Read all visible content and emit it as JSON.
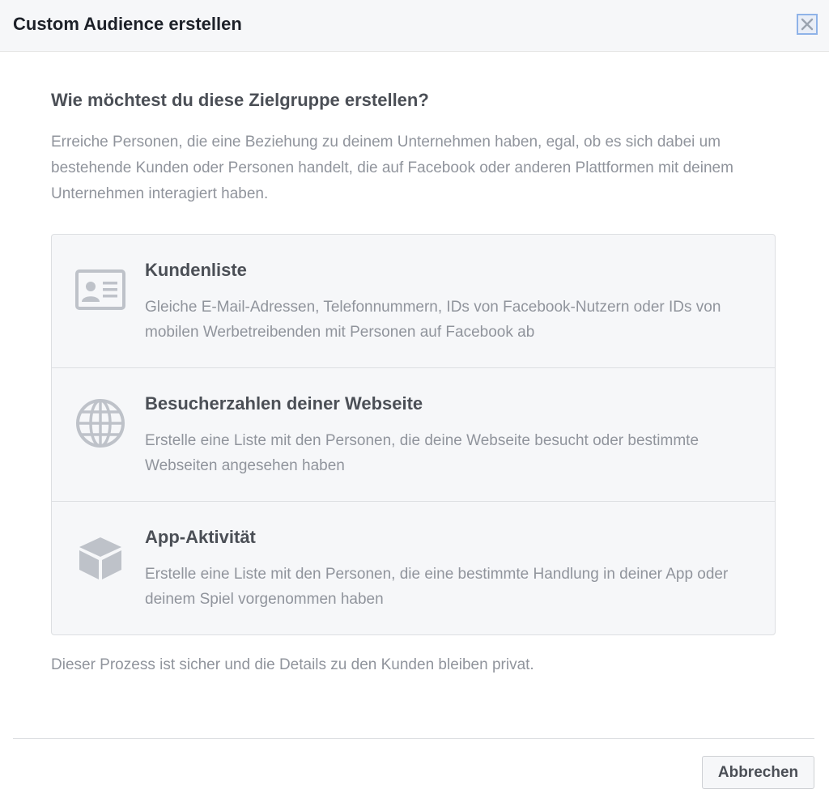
{
  "dialog": {
    "title": "Custom Audience erstellen",
    "close_icon": "close-icon"
  },
  "content": {
    "question": "Wie möchtest du diese Zielgruppe erstellen?",
    "intro": "Erreiche Personen, die eine Beziehung zu deinem Unternehmen haben, egal, ob es sich dabei um bestehende Kunden oder Personen handelt, die auf Facebook oder anderen Plattformen mit deinem Unternehmen interagiert haben.",
    "options": [
      {
        "icon": "contact-card-icon",
        "title": "Kundenliste",
        "description": "Gleiche E-Mail-Adressen, Telefonnummern, IDs von Facebook-Nutzern oder IDs von mobilen Werbetreibenden mit Personen auf Facebook ab"
      },
      {
        "icon": "globe-icon",
        "title": "Besucherzahlen deiner Webseite",
        "description": "Erstelle eine Liste mit den Personen, die deine Webseite besucht oder bestimmte Webseiten angesehen haben"
      },
      {
        "icon": "cube-icon",
        "title": "App-Aktivität",
        "description": "Erstelle eine Liste mit den Personen, die eine bestimmte Handlung in deiner App oder deinem Spiel vorgenommen haben"
      }
    ],
    "privacy_note": "Dieser Prozess ist sicher und die Details zu den Kunden bleiben privat."
  },
  "footer": {
    "cancel_label": "Abbrechen"
  },
  "colors": {
    "header_bg": "#f6f7f9",
    "text_dark": "#1d2129",
    "text_heading": "#4b4f56",
    "text_muted": "#90949c",
    "icon_gray": "#bec2c9"
  }
}
